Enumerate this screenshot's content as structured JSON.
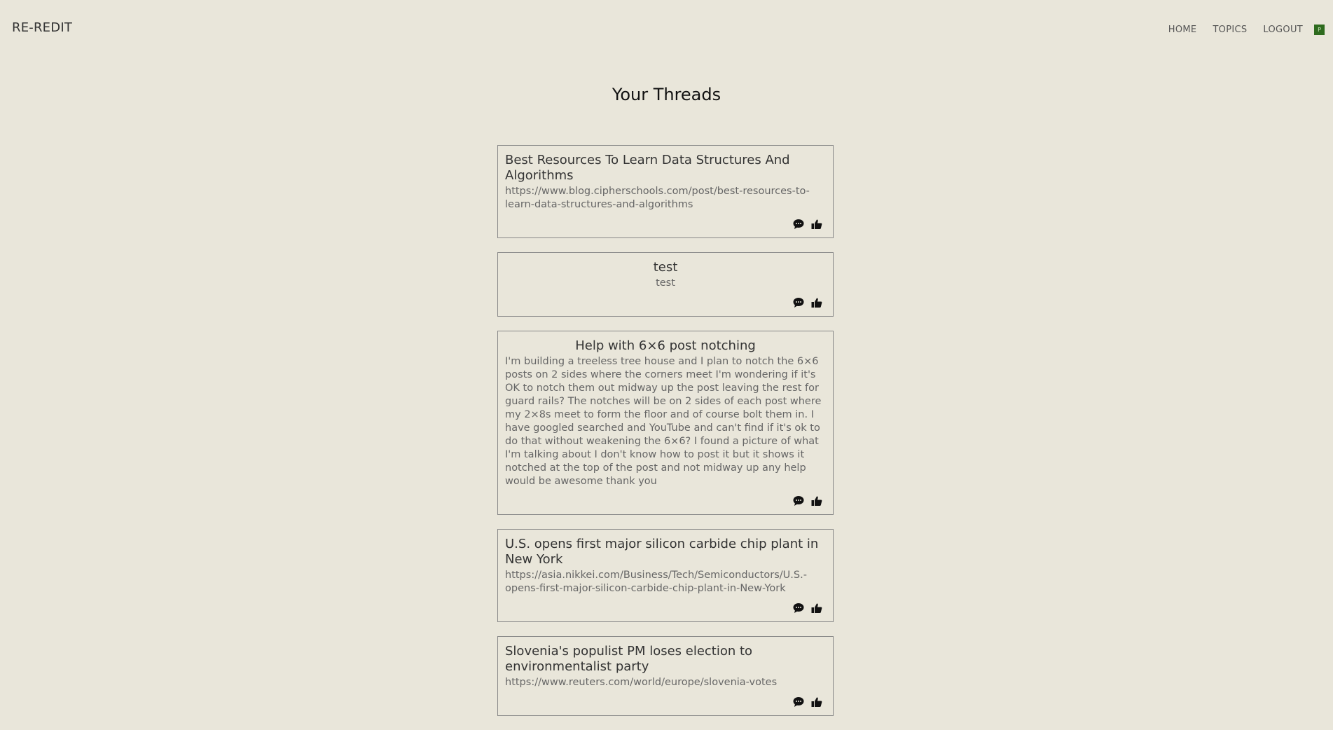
{
  "header": {
    "brand": "RE-REDIT",
    "nav": {
      "home": "HOME",
      "topics": "TOPICS",
      "logout": "LOGOUT"
    },
    "avatar_initial": "P",
    "avatar_color": "#2e6b1e"
  },
  "page": {
    "title": "Your Threads"
  },
  "threads": [
    {
      "title": "Best Resources To Learn Data Structures And Algorithms",
      "body": "https://www.blog.cipherschools.com/post/best-resources-to-learn-data-structures-and-algorithms"
    },
    {
      "title": "test",
      "body": "test"
    },
    {
      "title": "Help with 6×6 post notching",
      "body": "I'm building a treeless tree house and I plan to notch the 6×6 posts on 2 sides where the corners meet I'm wondering if it's OK to notch them out midway up the post leaving the rest for guard rails? The notches will be on 2 sides of each post where my 2×8s meet to form the floor and of course bolt them in. I have googled searched and YouTube and can't find if it's ok to do that without weakening the 6×6? I found a picture of what I'm talking about I don't know how to post it but it shows it notched at the top of the post and not midway up any help would be awesome thank you"
    },
    {
      "title": "U.S. opens first major silicon carbide chip plant in New York",
      "body": "https://asia.nikkei.com/Business/Tech/Semiconductors/U.S.-opens-first-major-silicon-carbide-chip-plant-in-New-York"
    },
    {
      "title": "Slovenia's populist PM loses election to environmentalist party",
      "body": "https://www.reuters.com/world/europe/slovenia-votes"
    }
  ],
  "icons": {
    "comment": "comment-icon",
    "like": "thumbs-up-icon"
  }
}
